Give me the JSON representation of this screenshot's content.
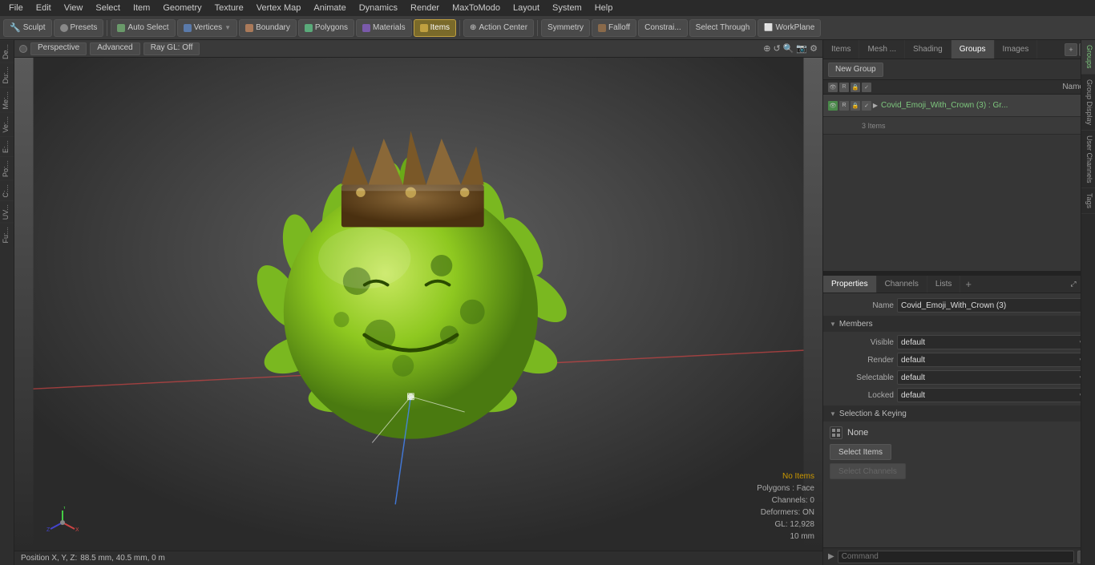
{
  "menubar": {
    "items": [
      "File",
      "Edit",
      "View",
      "Select",
      "Item",
      "Geometry",
      "Texture",
      "Vertex Map",
      "Animate",
      "Dynamics",
      "Render",
      "MaxToModo",
      "Layout",
      "System",
      "Help"
    ]
  },
  "toolbar": {
    "sculpt_label": "Sculpt",
    "presets_label": "Presets",
    "auto_select_label": "Auto Select",
    "vertices_label": "Vertices",
    "boundary_label": "Boundary",
    "polygons_label": "Polygons",
    "materials_label": "Materials",
    "items_label": "Items",
    "action_center_label": "Action Center",
    "symmetry_label": "Symmetry",
    "falloff_label": "Falloff",
    "constrai_label": "Constrai...",
    "select_through_label": "Select Through",
    "workplane_label": "WorkPlane"
  },
  "viewport_header": {
    "perspective_label": "Perspective",
    "advanced_label": "Advanced",
    "ray_gl_label": "Ray GL: Off"
  },
  "viewport_info": {
    "no_items": "No Items",
    "polygons": "Polygons : Face",
    "channels": "Channels: 0",
    "deformers": "Deformers: ON",
    "gl": "GL: 12,928",
    "mm": "10 mm"
  },
  "position_bar": {
    "label": "Position X, Y, Z:",
    "values": "88.5 mm, 40.5 mm, 0 m"
  },
  "left_tabs": [
    "De...",
    "Du:...",
    "Me:...",
    "Ve:...",
    "E:...",
    "Po:...",
    "C:...",
    "UV...",
    "Fu:..."
  ],
  "right_top_tabs": {
    "items": [
      {
        "label": "Items",
        "active": false
      },
      {
        "label": "Mesh ...",
        "active": false
      },
      {
        "label": "Shading",
        "active": false
      },
      {
        "label": "Groups",
        "active": true
      },
      {
        "label": "Images",
        "active": false
      }
    ],
    "add_label": "+"
  },
  "groups_panel": {
    "new_group_label": "New Group",
    "col_name": "Name",
    "group_name": "Covid_Emoji_With_Crown (3) : Gr...",
    "group_name_short": "Covid_Emoji_With_Crown (3)",
    "sub_label": "3 Items"
  },
  "props_panel": {
    "tabs": [
      "Properties",
      "Channels",
      "Lists"
    ],
    "add_label": "+",
    "name_label": "Name",
    "name_value": "Covid_Emoji_With_Crown (3)",
    "members_label": "Members",
    "visible_label": "Visible",
    "visible_value": "default",
    "render_label": "Render",
    "render_value": "default",
    "selectable_label": "Selectable",
    "selectable_value": "default",
    "locked_label": "Locked",
    "locked_value": "default",
    "selection_keying_label": "Selection & Keying",
    "none_label": "None",
    "select_items_label": "Select Items",
    "select_channels_label": "Select Channels"
  },
  "right_side_tabs": [
    "Groups",
    "Group Display",
    "User Channels",
    "Tags"
  ],
  "command_bar": {
    "label": "Command",
    "placeholder": "Command"
  },
  "colors": {
    "accent_green": "#7ec87e",
    "bg_dark": "#2e2e2e",
    "bg_mid": "#3a3a3a",
    "bg_light": "#4a4a4a",
    "border": "#444"
  }
}
